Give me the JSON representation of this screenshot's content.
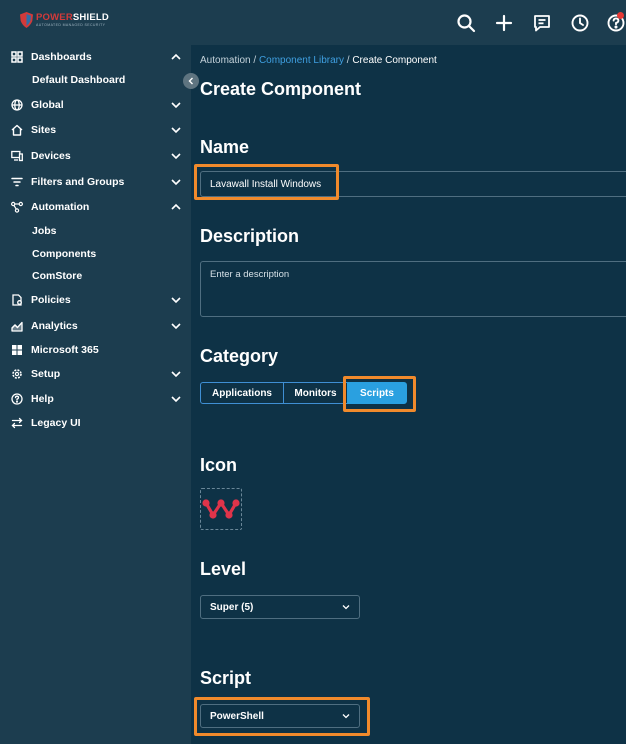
{
  "brand": {
    "name_part1": "POWER",
    "name_part2": "SHIELD",
    "tagline": "AUTOMATED MANAGED SECURITY"
  },
  "sidebar": {
    "items": [
      {
        "label": "Dashboards",
        "icon": "grid-icon",
        "chevron": "up"
      },
      {
        "label": "Default Dashboard",
        "sub": true
      },
      {
        "label": "Global",
        "icon": "globe-icon",
        "chevron": "down"
      },
      {
        "label": "Sites",
        "icon": "home-icon",
        "chevron": "down"
      },
      {
        "label": "Devices",
        "icon": "devices-icon",
        "chevron": "down"
      },
      {
        "label": "Filters and Groups",
        "icon": "filter-icon",
        "chevron": "down"
      },
      {
        "label": "Automation",
        "icon": "automation-icon",
        "chevron": "up"
      },
      {
        "label": "Jobs",
        "sub": true
      },
      {
        "label": "Components",
        "sub": true
      },
      {
        "label": "ComStore",
        "sub": true
      },
      {
        "label": "Policies",
        "icon": "policies-icon",
        "chevron": "down"
      },
      {
        "label": "Analytics",
        "icon": "analytics-icon",
        "chevron": "down"
      },
      {
        "label": "Microsoft 365",
        "icon": "microsoft-icon"
      },
      {
        "label": "Setup",
        "icon": "gear-icon",
        "chevron": "down"
      },
      {
        "label": "Help",
        "icon": "help-icon",
        "chevron": "down"
      },
      {
        "label": "Legacy UI",
        "icon": "swap-icon"
      }
    ]
  },
  "breadcrumb": {
    "part1": "Automation",
    "separator": " / ",
    "part2": "Component Library",
    "part3": "Create Component"
  },
  "page": {
    "title": "Create Component",
    "name_label": "Name",
    "name_value": "Lavawall Install Windows",
    "description_label": "Description",
    "description_placeholder": "Enter a description",
    "category_label": "Category",
    "categories": [
      "Applications",
      "Monitors",
      "Scripts"
    ],
    "selected_category": "Scripts",
    "icon_label": "Icon",
    "level_label": "Level",
    "level_value": "Super (5)",
    "script_label": "Script",
    "script_value": "PowerShell"
  },
  "colors": {
    "accent": "#2aa0e0",
    "highlight": "#f08a2c",
    "background": "#0e3246",
    "sidebar": "#1c3d4f",
    "link": "#3f9fe0",
    "logo_red": "#e0344a"
  }
}
